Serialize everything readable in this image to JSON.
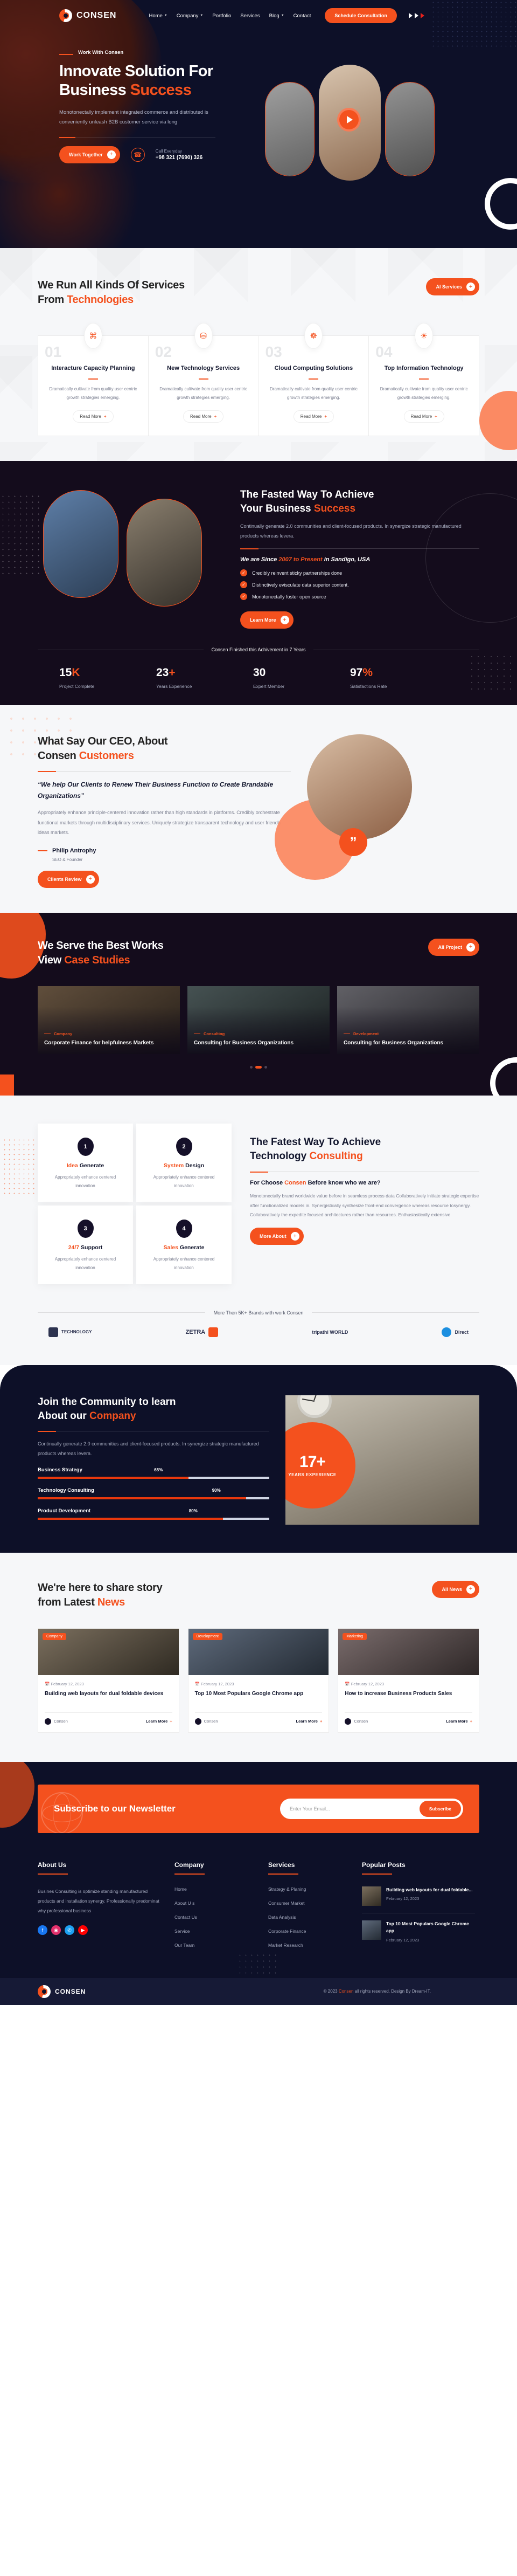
{
  "brand": {
    "name": "CONSEN",
    "accent": "#f4511e",
    "dark": "#0d1028"
  },
  "nav": {
    "items": [
      {
        "label": "Home",
        "caret": true
      },
      {
        "label": "Company",
        "caret": true
      },
      {
        "label": "Portfolio",
        "caret": false
      },
      {
        "label": "Services",
        "caret": false
      },
      {
        "label": "Blog",
        "caret": true
      },
      {
        "label": "Contact",
        "caret": false
      }
    ],
    "cta": "Schedule Consultation"
  },
  "hero": {
    "eyebrow": "Work With Consen",
    "title_line1": "Innovate Solution For",
    "title_line2a": "Business ",
    "title_line2b": "Success",
    "paragraph": "Monotonectally implement integrated commerce and distributed is conveniently unleash B2B customer service via long",
    "cta": "Work Together",
    "call_label": "Call Everyday",
    "call_number": "+98 321 (7690) 326"
  },
  "services": {
    "title_line1": "We Run All Kinds Of Services",
    "title_line2a": "From ",
    "title_line2b": "Technologies",
    "cta": "Al Services",
    "read_more": "Read More",
    "cards": [
      {
        "num": "01",
        "icon": "monitor-bug-icon",
        "glyph": "⌘",
        "title": "Interacture Capacity Planning",
        "desc": "Dramatically cultivate from quality user centric growth strategies emerging."
      },
      {
        "num": "02",
        "icon": "money-bag-icon",
        "glyph": "⛁",
        "title": "New Technology Services",
        "desc": "Dramatically cultivate from quality user centric growth strategies emerging."
      },
      {
        "num": "03",
        "icon": "cloud-network-icon",
        "glyph": "☸",
        "title": "Cloud Computing Solutions",
        "desc": "Dramatically cultivate from quality user centric growth strategies emerging."
      },
      {
        "num": "04",
        "icon": "lightbulb-icon",
        "glyph": "☀",
        "title": "Top Information Technology",
        "desc": "Dramatically cultivate from quality user centric growth strategies emerging."
      }
    ]
  },
  "about": {
    "title_line1": "The Fasted Way To Achieve",
    "title_line2a": "Your Business ",
    "title_line2b": "Success",
    "paragraph": "Continually generate 2.0 communities and client-focused products. In synergize strategic manufactured products whereas levera.",
    "since_a": "We are Since ",
    "since_b": "2007 to Present",
    "since_c": " in Sandigo, USA",
    "bullets": [
      "Credibly reinvent sticky partnerships done",
      "Distinctively evisculate data superior content.",
      "Monotonectally foster open source"
    ],
    "cta": "Learn More",
    "achievement_line": "Consen Finished this Achivement in 7 Years",
    "stats": [
      {
        "value": "15",
        "suffix": "K",
        "label": "Project Complete"
      },
      {
        "value": "23",
        "suffix": "+",
        "label": "Years Experience"
      },
      {
        "value": "30",
        "suffix": "",
        "label": "Expert Member"
      },
      {
        "value": "97",
        "suffix": "%",
        "label": "Satisfactions Rate"
      }
    ]
  },
  "testimonial": {
    "title_line1": "What Say Our CEO, About",
    "title_line2a": "Consen ",
    "title_line2b": "Customers",
    "quote": "“We help Our Clients to Renew Their Business Function to Create Brandable Organizations”",
    "paragraph": "Appropriately enhance principle-centered innovation rather than high standards in platforms. Credibly orchestrate functional markets through multidisciplinary services. Uniquely strategize transparent technology and user friendly ideas markets.",
    "author": "Philip Antrophy",
    "role": "SEO & Founder",
    "cta": "Clients Review",
    "quote_mark": "”"
  },
  "cases": {
    "title_line1": "We Serve the Best Works",
    "title_line2a": "View ",
    "title_line2b": "Case Studies",
    "cta": "All Project",
    "items": [
      {
        "category": "Company",
        "title": "Corporate Finance for helpfulness Markets"
      },
      {
        "category": "Consulting",
        "title": "Consulting for Business Organizations"
      },
      {
        "category": "Development",
        "title": "Consulting for Business Organizations"
      }
    ]
  },
  "consulting": {
    "title_line1": "The Fatest Way To Achieve",
    "title_line2a": "Technology ",
    "title_line2b": "Consulting",
    "subtitle_a": "For Choose ",
    "subtitle_b": "Consen",
    "subtitle_c": " Before know who we are?",
    "paragraph": "Monotonectally brand worldwide value before in seamless process data Collaboratively initiate strategic expertise after functionalized models in. Synergistically synthesize front-end convergence whereas resource tosynergy. Collaboratively the expedite focused architectures rather than resources. Enthusiastically extensive",
    "cta": "More About",
    "steps": [
      {
        "num": "1",
        "title_a": "Idea",
        "title_b": " Generate",
        "desc": "Appropriately enhance centered innovation"
      },
      {
        "num": "2",
        "title_a": "System",
        "title_b": " Design",
        "desc": "Appropriately enhance centered innovation"
      },
      {
        "num": "3",
        "title_a": "24/7",
        "title_b": " Support",
        "desc": "Appropriately enhance centered innovation"
      },
      {
        "num": "4",
        "title_a": "Sales",
        "title_b": " Generate",
        "desc": "Appropriately enhance centered innovation"
      }
    ],
    "brands_line": "More Then 5K+ Brands with work Consen",
    "brands": [
      "TECHNOLOGY",
      "ZETRA",
      "tripathi WORLD",
      "Direct"
    ]
  },
  "community": {
    "title_line1": "Join the Community to learn",
    "title_line2a": "About our ",
    "title_line2b": "Company",
    "paragraph": "Continually generate 2.0 communities and client-focused products. In synergize strategic manufactured products whereas levera.",
    "skills": [
      {
        "name": "Business Strategy",
        "pct": "65%",
        "value": 65
      },
      {
        "name": "Technology Consulting",
        "pct": "90%",
        "value": 90
      },
      {
        "name": "Product Development",
        "pct": "80%",
        "value": 80
      }
    ],
    "badge_number": "17+",
    "badge_label": "YEARS EXPERIENCE"
  },
  "news": {
    "title_line1": "We're here to share story",
    "title_line2a": "from Latest ",
    "title_line2b": "News",
    "cta": "All News",
    "read_more": "Learn More",
    "items": [
      {
        "tag": "Company",
        "date": "February 12, 2023",
        "title": "Building web layouts for dual foldable devices",
        "author": "Consen"
      },
      {
        "tag": "Development",
        "date": "February 12, 2023",
        "title": "Top 10 Most Populars Google Chrome app",
        "author": "Consen"
      },
      {
        "tag": "Marketing",
        "date": "February 12, 2023",
        "title": "How to increase Business Products Sales",
        "author": "Consen"
      }
    ]
  },
  "newsletter": {
    "title": "Subscribe to our Newsletter",
    "placeholder": "Enter Your Email...",
    "button": "Subscribe"
  },
  "footer": {
    "about": {
      "heading": "About Us",
      "text": "Busines Consulting is optimize standing manufactured products and installation synergy. Professionally predominat why professional business",
      "socials": [
        {
          "name": "facebook-icon",
          "glyph": "f",
          "color": "#1877f2"
        },
        {
          "name": "instagram-icon",
          "glyph": "◉",
          "color": "#e1306c"
        },
        {
          "name": "twitter-icon",
          "glyph": "✆",
          "color": "#1da1f2"
        },
        {
          "name": "youtube-icon",
          "glyph": "▶",
          "color": "#ff0000"
        }
      ]
    },
    "company": {
      "heading": "Company",
      "links": [
        "Home",
        "About U s",
        "Contact Us",
        "Service",
        "Our Team"
      ]
    },
    "services": {
      "heading": "Services",
      "links": [
        "Strategy & Planing",
        "Consumer Market",
        "Data Analysis",
        "Corporate Finance",
        "Market Research"
      ]
    },
    "popular": {
      "heading": "Popular Posts",
      "posts": [
        {
          "title": "Building web layouts for dual foldable...",
          "date": "February 12, 2023"
        },
        {
          "title": "Top 10 Most Populars Google Chrome app",
          "date": "February 12, 2023"
        }
      ]
    },
    "copyright_a": "© 2023 ",
    "copyright_b": "Consen",
    "copyright_c": " all rights reserved. Design By Dream-IT."
  }
}
